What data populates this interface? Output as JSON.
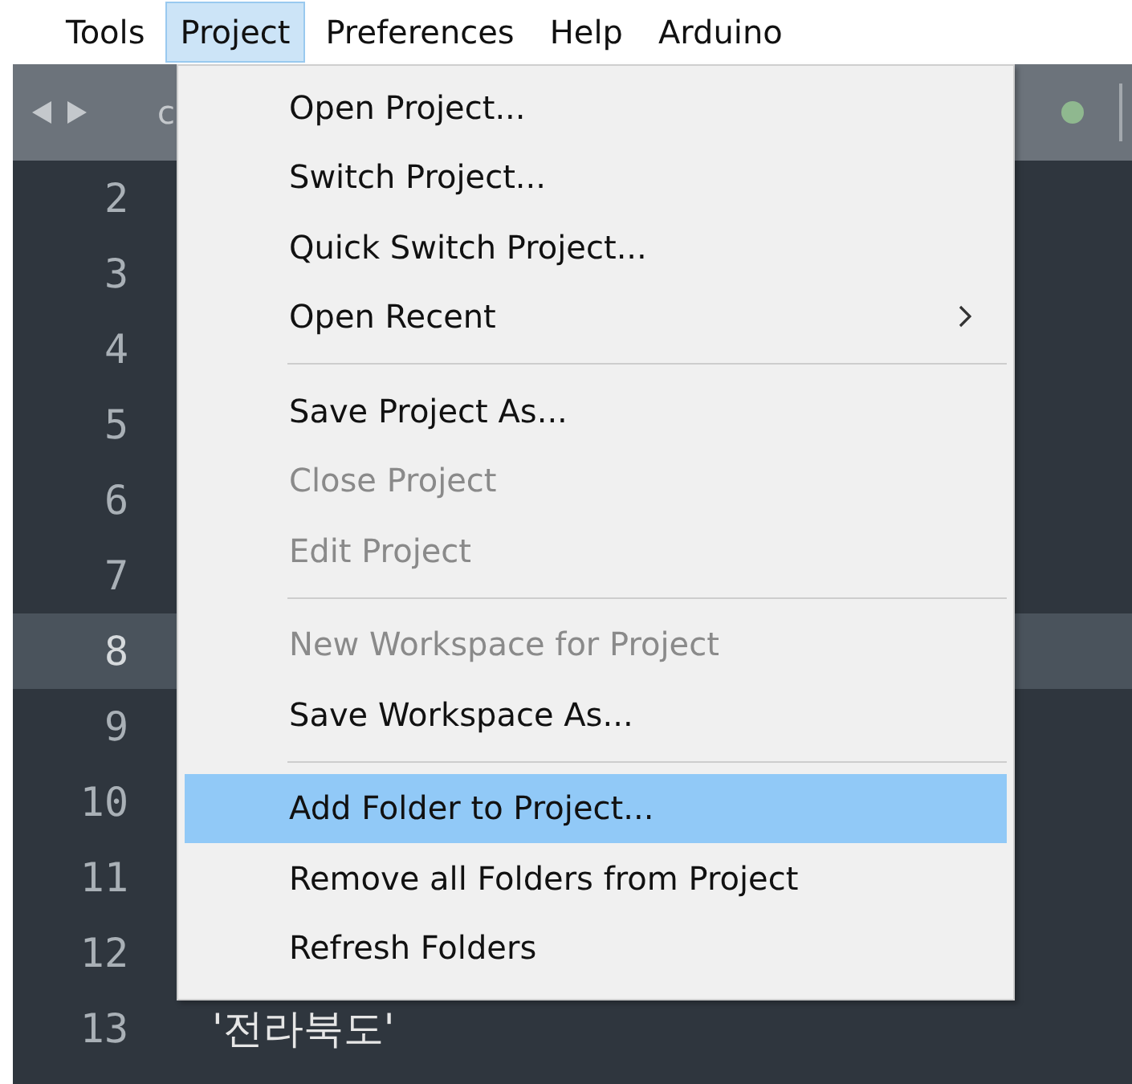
{
  "menubar": [
    {
      "label": "Tools",
      "selected": false
    },
    {
      "label": "Project",
      "selected": true
    },
    {
      "label": "Preferences",
      "selected": false
    },
    {
      "label": "Help",
      "selected": false
    },
    {
      "label": "Arduino",
      "selected": false
    }
  ],
  "tab_bar": {
    "tab_label": "c"
  },
  "editor": {
    "lines": [
      {
        "number": "2",
        "current": false
      },
      {
        "number": "3",
        "current": false
      },
      {
        "number": "4",
        "current": false
      },
      {
        "number": "5",
        "current": false
      },
      {
        "number": "6",
        "current": false
      },
      {
        "number": "7",
        "current": false
      },
      {
        "number": "8",
        "current": true
      },
      {
        "number": "9",
        "current": false
      },
      {
        "number": "10",
        "current": false
      },
      {
        "number": "11",
        "current": false
      },
      {
        "number": "12",
        "current": false
      },
      {
        "number": "13",
        "current": false,
        "code": "'전라북도'"
      }
    ]
  },
  "menu": {
    "items": [
      {
        "kind": "item",
        "label": "Open Project...",
        "disabled": false,
        "selected": false
      },
      {
        "kind": "item",
        "label": "Switch Project...",
        "disabled": false,
        "selected": false
      },
      {
        "kind": "item",
        "label": "Quick Switch Project...",
        "disabled": false,
        "selected": false
      },
      {
        "kind": "submenu",
        "label": "Open Recent",
        "disabled": false,
        "selected": false
      },
      {
        "kind": "separator"
      },
      {
        "kind": "item",
        "label": "Save Project As...",
        "disabled": false,
        "selected": false
      },
      {
        "kind": "item",
        "label": "Close Project",
        "disabled": true,
        "selected": false
      },
      {
        "kind": "item",
        "label": "Edit Project",
        "disabled": true,
        "selected": false
      },
      {
        "kind": "separator"
      },
      {
        "kind": "item",
        "label": "New Workspace for Project",
        "disabled": true,
        "selected": false
      },
      {
        "kind": "item",
        "label": "Save Workspace As...",
        "disabled": false,
        "selected": false
      },
      {
        "kind": "separator"
      },
      {
        "kind": "item",
        "label": "Add Folder to Project...",
        "disabled": false,
        "selected": true
      },
      {
        "kind": "item",
        "label": "Remove all Folders from Project",
        "disabled": false,
        "selected": false
      },
      {
        "kind": "item",
        "label": "Refresh Folders",
        "disabled": false,
        "selected": false
      }
    ]
  }
}
